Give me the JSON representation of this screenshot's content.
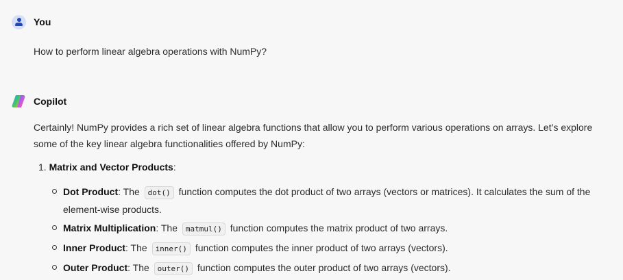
{
  "user": {
    "name": "You",
    "message": "How to perform linear algebra operations with NumPy?"
  },
  "assistant": {
    "name": "Copilot",
    "intro": "Certainly! NumPy provides a rich set of linear algebra functions that allow you to perform various operations on arrays. Let’s explore some of the key linear algebra functionalities offered by NumPy:",
    "section": {
      "number": "1.",
      "title": "Matrix and Vector Products",
      "suffix": ":"
    },
    "items": [
      {
        "term": "Dot Product",
        "pre": ": The",
        "code": "dot()",
        "post": "function computes the dot product of two arrays (vectors or matrices). It calculates the sum of the element-wise products."
      },
      {
        "term": "Matrix Multiplication",
        "pre": ": The",
        "code": "matmul()",
        "post": "function computes the matrix product of two arrays."
      },
      {
        "term": "Inner Product",
        "pre": ": The",
        "code": "inner()",
        "post": "function computes the inner product of two arrays (vectors)."
      },
      {
        "term": "Outer Product",
        "pre": ": The",
        "code": "outer()",
        "post": "function computes the outer product of two arrays (vectors)."
      }
    ]
  }
}
